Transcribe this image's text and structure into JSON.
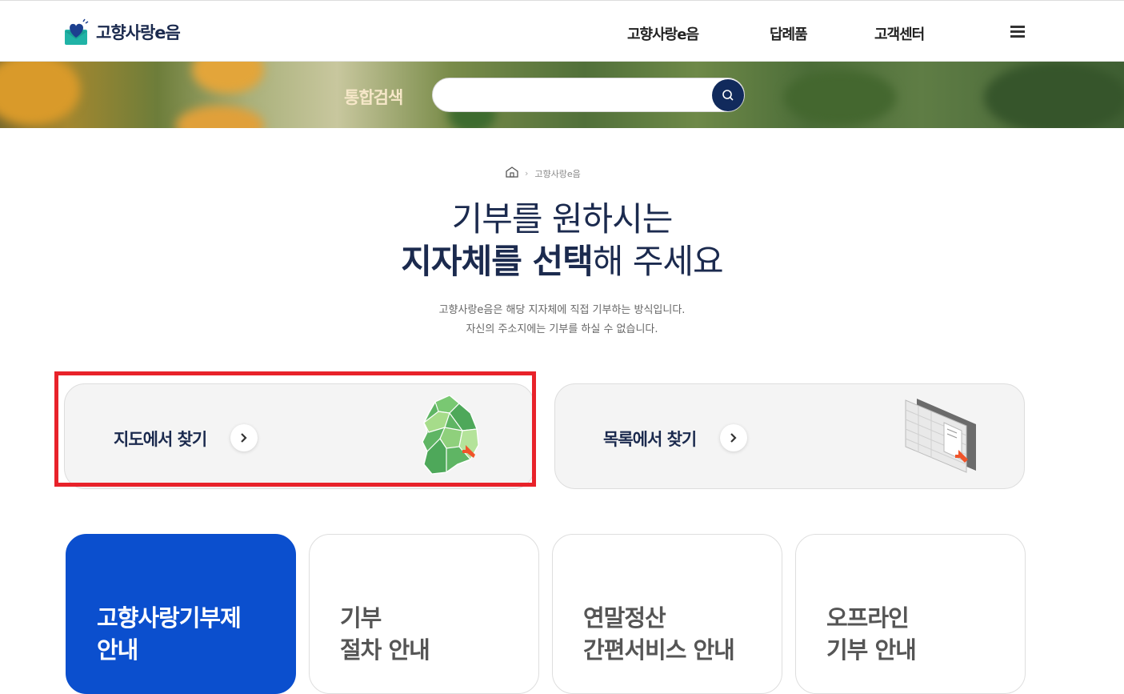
{
  "header": {
    "logo_text": "고향사랑e음",
    "nav": [
      "고향사랑e음",
      "답례품",
      "고객센터"
    ]
  },
  "search": {
    "label": "통합검색",
    "placeholder": ""
  },
  "breadcrumb": {
    "current": "고향사랑e음"
  },
  "hero": {
    "line1": "기부를 원하시는",
    "line2_bold": "지자체를 선택",
    "line2_rest": "해 주세요",
    "desc1": "고향사랑e음은 해당 지자체에 직접 기부하는 방식입니다.",
    "desc2": "자신의 주소지에는 기부를 하실 수 없습니다."
  },
  "find": {
    "map_label": "지도에서 찾기",
    "list_label": "목록에서 찾기"
  },
  "info_cards": [
    {
      "line1": "고향사랑기부제",
      "line2": "안내"
    },
    {
      "line1": "기부",
      "line2": "절차 안내"
    },
    {
      "line1": "연말정산",
      "line2": "간편서비스 안내"
    },
    {
      "line1": "오프라인",
      "line2": "기부 안내"
    }
  ],
  "colors": {
    "navy": "#1b2a4e",
    "active_card": "#0b4fce",
    "highlight": "#e8222a"
  }
}
